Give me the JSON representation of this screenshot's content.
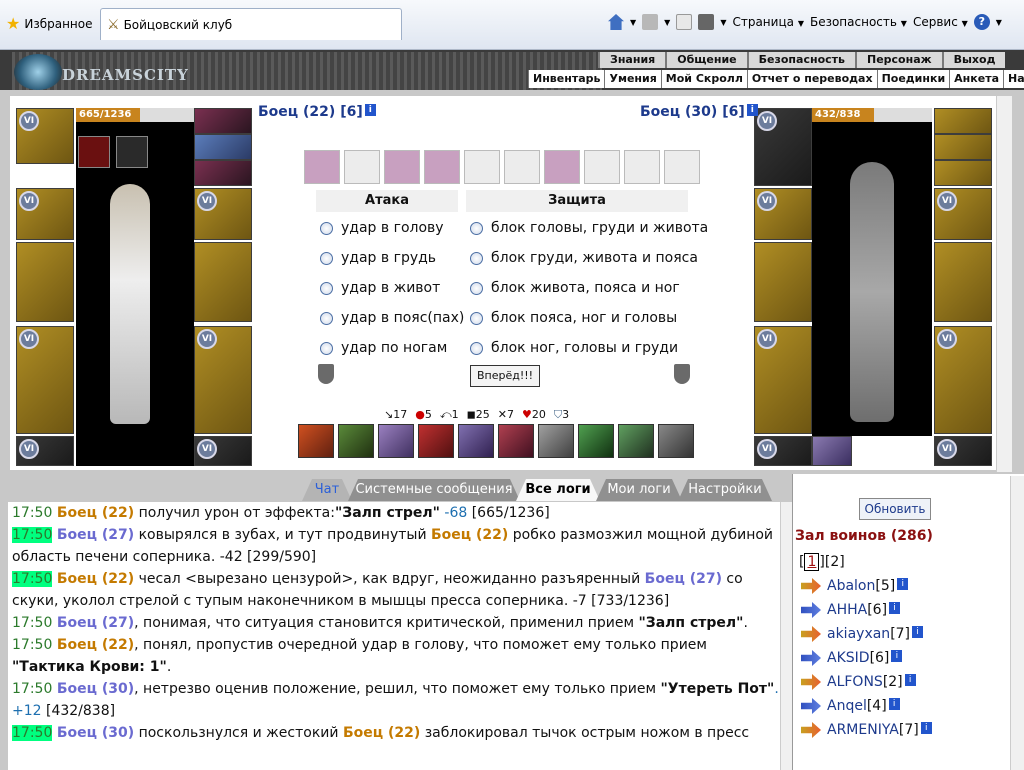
{
  "browser": {
    "favorites": "Избранное",
    "tab_title": "Бойцовский клуб",
    "tools": [
      "Страница",
      "Безопасность",
      "Сервис"
    ]
  },
  "game": {
    "logo": "DREAMSCITY",
    "menu_top": [
      "Знания",
      "Общение",
      "Безопасность",
      "Персонаж",
      "Выход"
    ],
    "menu_sub": [
      "Инвентарь",
      "Умения",
      "Мой Скролл",
      "Отчет о переводах",
      "Поединки",
      "Анкета",
      "Настро"
    ]
  },
  "battle": {
    "left_fighter": {
      "name": "Боец (22) [6]",
      "hp": "665/1236",
      "hp_fraction": 0.54
    },
    "right_fighter": {
      "name": "Боец (30) [6]",
      "hp": "432/838",
      "hp_fraction": 0.52
    },
    "attack_header": "Атака",
    "defense_header": "Защита",
    "attacks": [
      "удар в голову",
      "удар в грудь",
      "удар в живот",
      "удар в пояс(пах)",
      "удар по ногам"
    ],
    "defenses": [
      "блок головы, груди и живота",
      "блок груди, живота и пояса",
      "блок живота, пояса и ног",
      "блок пояса, ног и головы",
      "блок ног, головы и груди"
    ],
    "go_button": "Вперёд!!!",
    "stats": [
      "17",
      "5",
      "1",
      "25",
      "7",
      "20",
      "3"
    ]
  },
  "chat": {
    "tabs": [
      "Чат",
      "Системные сообщения",
      "Все логи",
      "Мои логи",
      "Настройки"
    ],
    "lines": [
      {
        "time": "17:50",
        "a": "Боец (22)",
        "text": " получил урон от эффекта:",
        "b": "\"Залп стрел\"",
        "val": " -68",
        "hp": " [665/1236]"
      },
      {
        "time": "17:50",
        "a": "Боец (27)",
        "text": " ковырялся в зубах, и тут продвинутый ",
        "b": "Боец (22)",
        "val": "",
        "hp": " робко размозжил мощной дубиной область печени соперника. -42 [299/590]"
      },
      {
        "time": "17:50",
        "a": "Боец (22)",
        "text": " чесал <вырезано цензурой>, как вдруг, неожиданно разъяренный ",
        "b": "Боец (27)",
        "val": "",
        "hp": " со скуки, уколол стрелой с тупым наконечником в мышцы пресса соперника. -7 [733/1236]"
      },
      {
        "time": "17:50",
        "a": "Боец (27)",
        "text": ", понимая, что ситуация становится критической, применил прием ",
        "b": "\"Залп стрел\"",
        "val": "",
        "hp": "."
      },
      {
        "time": "17:50",
        "a": "Боец (22)",
        "text": ", понял, пропустив очередной удар в голову, что поможет ему только прием ",
        "b": "\"Тактика Крови: 1\"",
        "val": "",
        "hp": "."
      },
      {
        "time": "17:50",
        "a": "Боец (30)",
        "text": ", нетрезво оценив положение, решил, что поможет ему только прием ",
        "b": "\"Утереть Пот\"",
        "val": ". +12",
        "hp": " [432/838]"
      },
      {
        "time": "17:50",
        "a": "Боец (30)",
        "text": " поскользнулся и жестокий ",
        "b": "Боец (22)",
        "val": "",
        "hp": " заблокировал тычок острым ножом в пресс"
      }
    ]
  },
  "side": {
    "refresh": "Обновить",
    "hall": "Зал воинов (286)",
    "pages_current": "1",
    "pages_other": "2",
    "players": [
      {
        "name": "Abalon",
        "level": "[5]"
      },
      {
        "name": "АННА",
        "level": "[6]"
      },
      {
        "name": "akiayxan",
        "level": "[7]"
      },
      {
        "name": "AKSID",
        "level": "[6]"
      },
      {
        "name": "ALFONS",
        "level": "[2]"
      },
      {
        "name": "Anqel",
        "level": "[4]"
      },
      {
        "name": "ARMENIYA",
        "level": "[7]"
      }
    ]
  }
}
